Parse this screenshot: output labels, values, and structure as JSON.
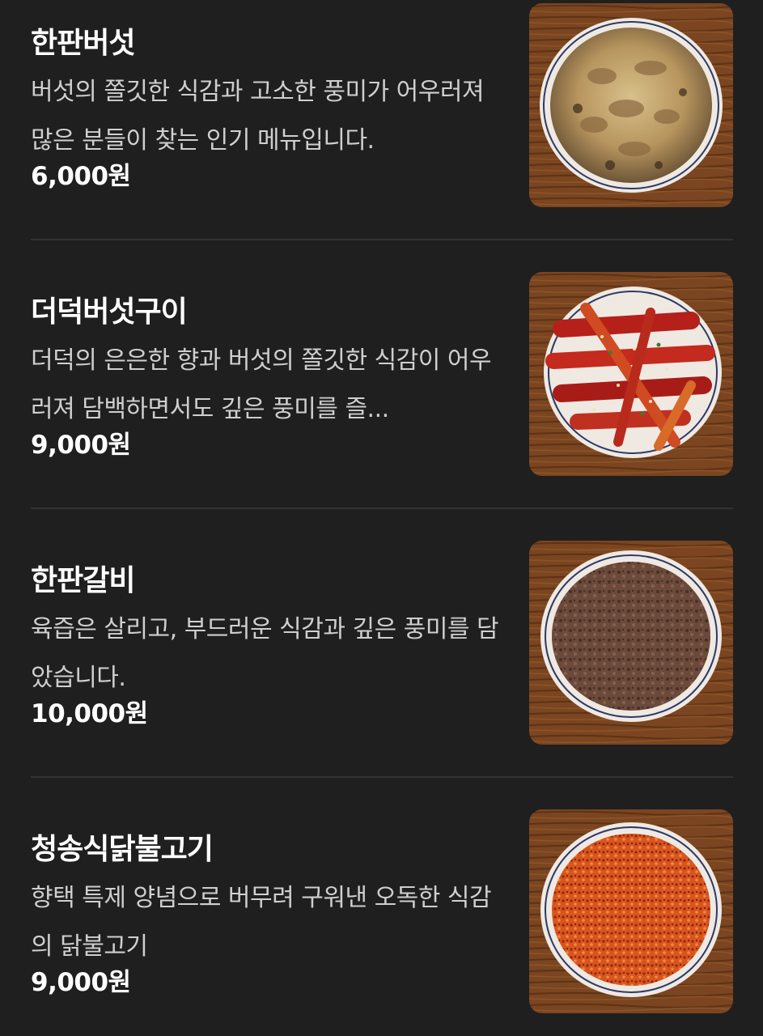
{
  "menu": {
    "items": [
      {
        "name": "한판버섯",
        "description": "버섯의 쫄깃한 식감과 고소한 풍미가 어우러져 많은 분들이 찾는 인기 메뉴입니다.",
        "price": "6,000원",
        "image_icon": "mushroom-dish-photo"
      },
      {
        "name": "더덕버섯구이",
        "description": "더덕의 은은한 향과 버섯의 쫄깃한 식감이 어우러져 담백하면서도 깊은 풍미를 즐...",
        "price": "9,000원",
        "image_icon": "deodeok-mushroom-dish-photo"
      },
      {
        "name": "한판갈비",
        "description": "육즙은 살리고, 부드러운 식감과 깊은 풍미를 담았습니다.",
        "price": "10,000원",
        "image_icon": "galbi-dish-photo"
      },
      {
        "name": "청송식닭불고기",
        "description": "향택 특제 양념으로 버무려 구워낸 오독한 식감의 닭불고기",
        "price": "9,000원",
        "image_icon": "chicken-bulgogi-dish-photo"
      }
    ]
  },
  "colors": {
    "background": "#1f1f1f",
    "divider": "#333333",
    "text_primary": "#ffffff",
    "text_secondary": "#cfcfcf",
    "wood": "#7a4520"
  }
}
